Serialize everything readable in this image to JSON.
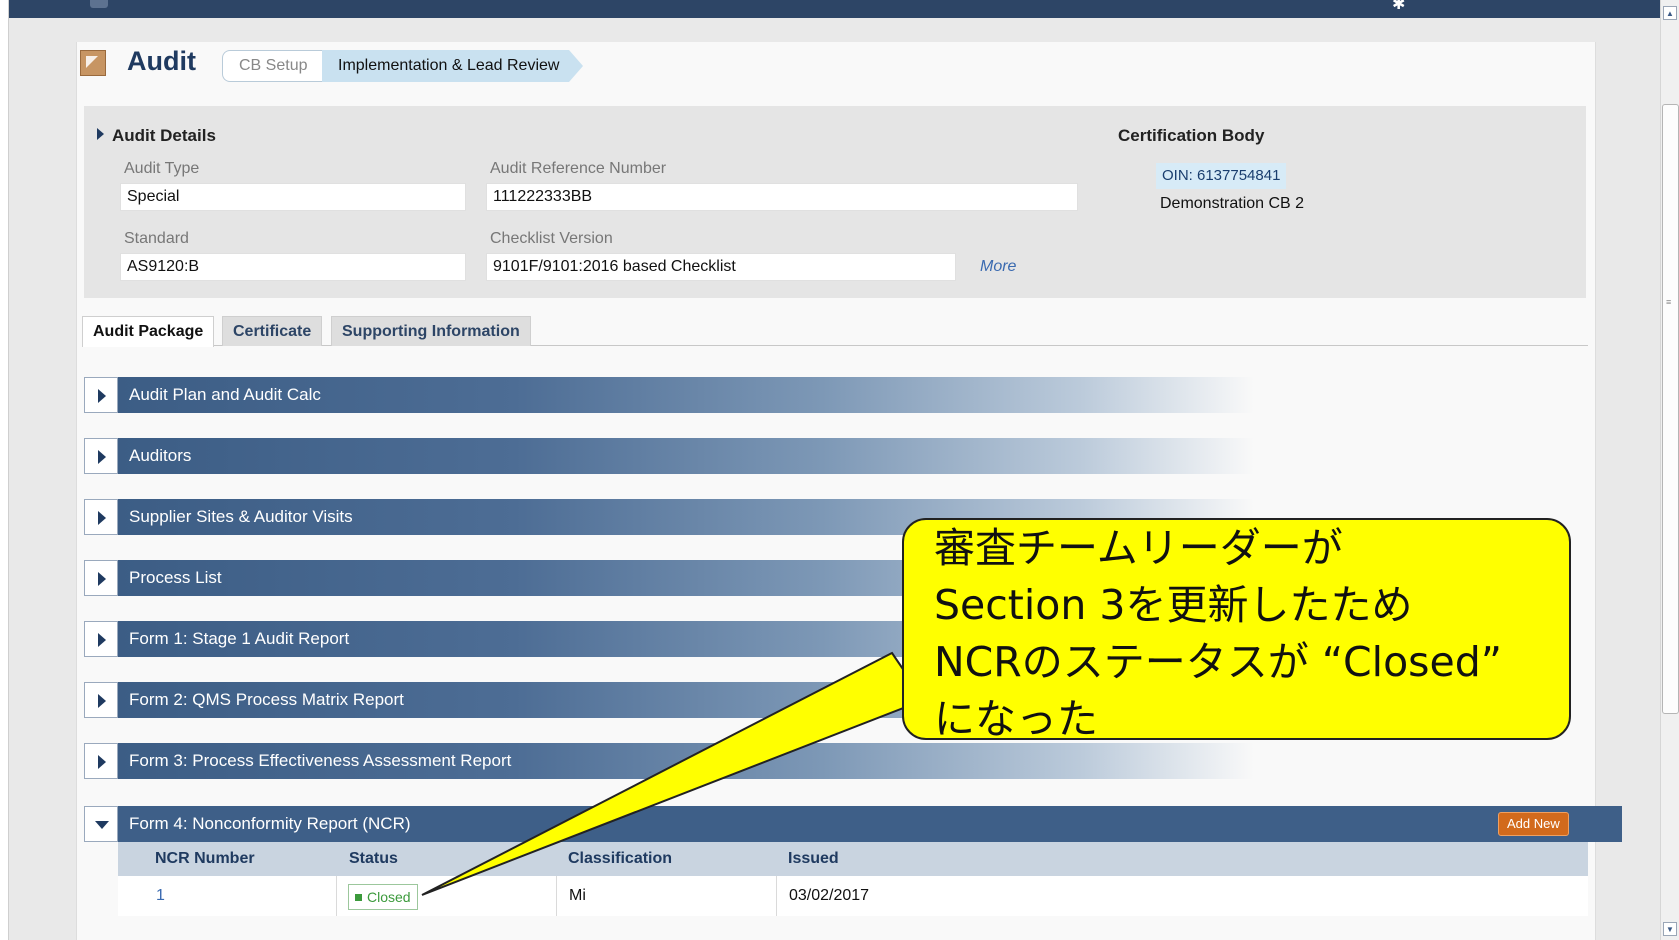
{
  "header": {
    "title": "Audit",
    "steps": [
      "CB Setup",
      "Implementation & Lead Review"
    ]
  },
  "details": {
    "heading": "Audit Details",
    "audit_type_label": "Audit Type",
    "audit_type": "Special",
    "ref_label": "Audit Reference Number",
    "ref": "111222333BB",
    "standard_label": "Standard",
    "standard": "AS9120:B",
    "checklist_label": "Checklist Version",
    "checklist": "9101F/9101:2016 based Checklist",
    "more": "More"
  },
  "cert_body": {
    "heading": "Certification Body",
    "oin": "OIN: 6137754841",
    "name": "Demonstration CB 2"
  },
  "tabs": [
    "Audit Package",
    "Certificate",
    "Supporting Information"
  ],
  "sections": [
    "Audit Plan and Audit Calc",
    "Auditors",
    "Supplier Sites & Auditor Visits",
    "Process List",
    "Form 1: Stage 1 Audit Report",
    "Form 2: QMS Process Matrix Report",
    "Form 3: Process Effectiveness Assessment Report",
    "Form 4: Nonconformity Report (NCR)"
  ],
  "ncr": {
    "add_new": "Add New",
    "columns": [
      "NCR Number",
      "Status",
      "Classification",
      "Issued"
    ],
    "rows": [
      {
        "number": "1",
        "status": "Closed",
        "classification": "Mi",
        "issued": "03/02/2017"
      }
    ]
  },
  "callout": {
    "lines": [
      "審査チームリーダーが",
      "Section 3を更新したため",
      "NCRのステータスが “Closed”",
      "になった"
    ],
    "fill": "#ffff00"
  },
  "colors": {
    "nav": "#2d4566",
    "section_band": "#3e5f88",
    "accent_orange": "#d26a1c",
    "status_green": "#3c9a3c"
  }
}
